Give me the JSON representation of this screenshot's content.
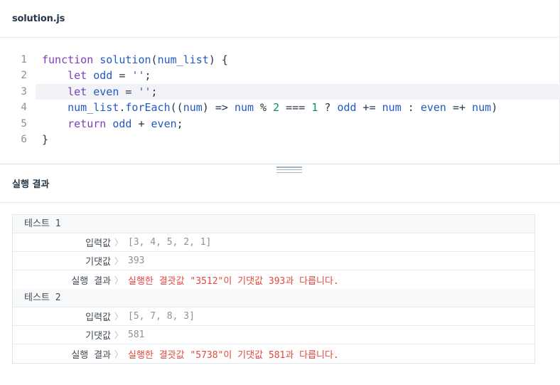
{
  "file": {
    "name": "solution.js"
  },
  "editor": {
    "lines": [
      {
        "n": "1",
        "tokens": [
          [
            "kw",
            "function "
          ],
          [
            "fn",
            "solution"
          ],
          [
            "op",
            "("
          ],
          [
            "var",
            "num_list"
          ],
          [
            "op",
            ") {"
          ]
        ]
      },
      {
        "n": "2",
        "tokens": [
          [
            "op",
            "    "
          ],
          [
            "kw",
            "let "
          ],
          [
            "var",
            "odd"
          ],
          [
            "op",
            " = "
          ],
          [
            "str",
            "''"
          ],
          [
            "op",
            ";"
          ]
        ]
      },
      {
        "n": "3",
        "tokens": [
          [
            "op",
            "    "
          ],
          [
            "kw",
            "let "
          ],
          [
            "var",
            "even"
          ],
          [
            "op",
            " = "
          ],
          [
            "str",
            "''"
          ],
          [
            "op",
            ";"
          ]
        ]
      },
      {
        "n": "4",
        "tokens": [
          [
            "op",
            "    "
          ],
          [
            "var",
            "num_list"
          ],
          [
            "op",
            "."
          ],
          [
            "fn",
            "forEach"
          ],
          [
            "op",
            "(("
          ],
          [
            "var",
            "num"
          ],
          [
            "op",
            ") => "
          ],
          [
            "var",
            "num"
          ],
          [
            "op",
            " % "
          ],
          [
            "numl",
            "2"
          ],
          [
            "op",
            " === "
          ],
          [
            "numl",
            "1"
          ],
          [
            "op",
            " ? "
          ],
          [
            "var",
            "odd"
          ],
          [
            "op",
            " += "
          ],
          [
            "var",
            "num"
          ],
          [
            "op",
            " : "
          ],
          [
            "var",
            "even"
          ],
          [
            "op",
            " =+ "
          ],
          [
            "var",
            "num"
          ],
          [
            "op",
            ")"
          ]
        ]
      },
      {
        "n": "5",
        "tokens": [
          [
            "op",
            "    "
          ],
          [
            "kw",
            "return "
          ],
          [
            "var",
            "odd"
          ],
          [
            "op",
            " + "
          ],
          [
            "var",
            "even"
          ],
          [
            "op",
            ";"
          ]
        ]
      },
      {
        "n": "6",
        "tokens": [
          [
            "op",
            "}"
          ]
        ]
      }
    ],
    "active_line": 3
  },
  "results": {
    "title": "실행 결과",
    "tests": [
      {
        "title": "테스트 1",
        "rows": [
          {
            "label": "입력값",
            "sep": "〉",
            "value": "[3, 4, 5, 2, 1]",
            "error": false
          },
          {
            "label": "기댓값",
            "sep": "〉",
            "value": "393",
            "error": false
          },
          {
            "label": "실행 결과",
            "sep": "〉",
            "value": "실행한 결괏값 \"3512\"이 기댓값 393과 다릅니다.",
            "error": true
          }
        ]
      },
      {
        "title": "테스트 2",
        "rows": [
          {
            "label": "입력값",
            "sep": "〉",
            "value": "[5, 7, 8, 3]",
            "error": false
          },
          {
            "label": "기댓값",
            "sep": "〉",
            "value": "581",
            "error": false
          },
          {
            "label": "실행 결과",
            "sep": "〉",
            "value": "실행한 결괏값 \"5738\"이 기댓값 581과 다릅니다.",
            "error": true
          }
        ]
      }
    ]
  },
  "colors": {
    "keyword": "#7d3cbd",
    "identifier": "#2359c4",
    "number": "#0e8a6c",
    "error": "#e4473e"
  }
}
